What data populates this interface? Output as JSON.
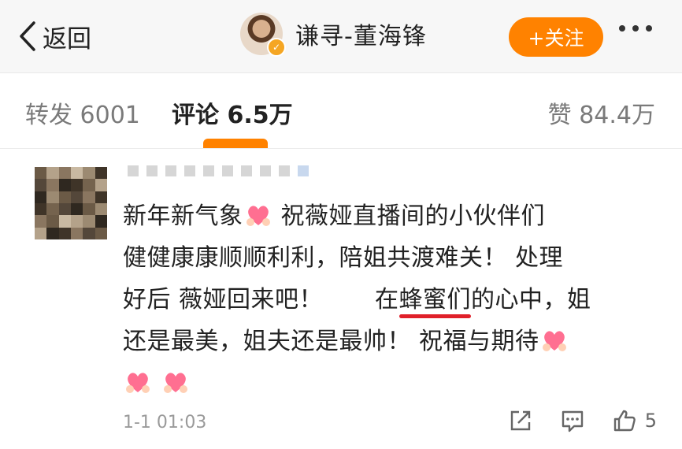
{
  "header": {
    "back_label": "返回",
    "profile_name": "谦寻-董海锋",
    "follow_label": "+关注"
  },
  "tabs": {
    "repost": "转发 6001",
    "comments": "评论 6.5万",
    "likes": "赞 84.4万"
  },
  "comment": {
    "line1_a": "新年新气象",
    "line1_b": " 祝薇娅直播间的小伙伴们",
    "line2": "健健康康顺顺利利，陪姐共渡难关！ 处理",
    "line3_a": "好后 薇娅回来吧！",
    "line3_b": "在",
    "line3_underlined": "蜂蜜们",
    "line3_c": "的心中，姐",
    "line4": "还是最美，姐夫还是最帅！ 祝福与期待",
    "timestamp": "1-1 01:03",
    "like_count": "5",
    "heart_icon": "pink-heart-hands-emoji"
  },
  "colors": {
    "accent": "#ff8200",
    "underline": "#e0202a"
  }
}
